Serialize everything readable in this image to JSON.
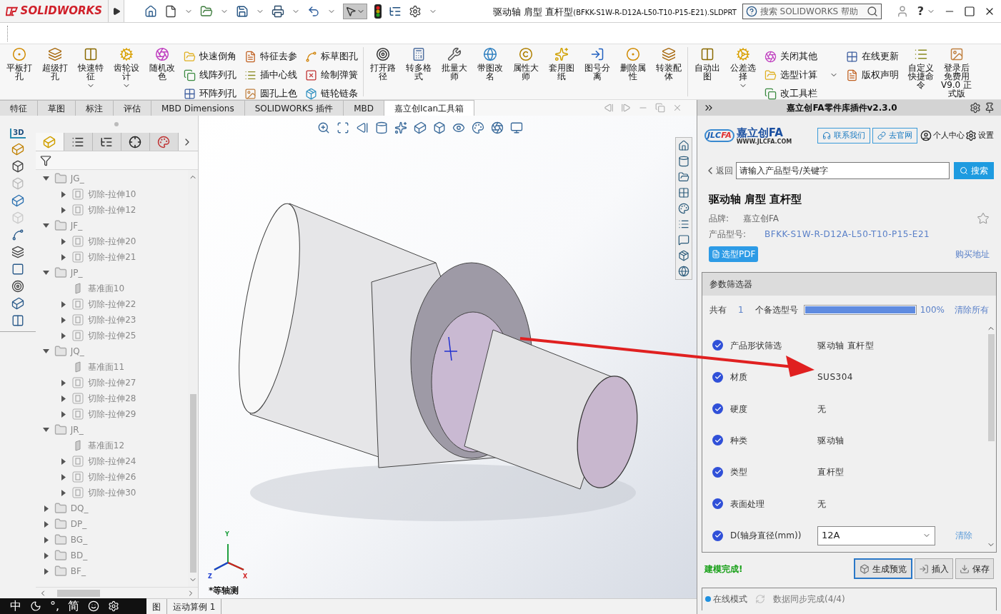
{
  "app": {
    "logo": "SOLIDWORKS",
    "title_main": "驱动轴 肩型 直杆型",
    "title_suffix": "(BFKK-S1W-R-D12A-L50-T10-P15-E21).SLDPRT",
    "help_search": {
      "placeholder": "搜索 SOLIDWORKS 帮助"
    },
    "help_mark": "?"
  },
  "ribbon": {
    "sections": [
      {
        "items": [
          {
            "kind": "large",
            "label": "平板打孔",
            "dropdown": false
          },
          {
            "kind": "large",
            "label": "超级打孔",
            "dropdown": false
          },
          {
            "kind": "large",
            "label": "快速特征",
            "dropdown": true
          },
          {
            "kind": "large",
            "label": "齿轮设计",
            "dropdown": true
          },
          {
            "kind": "large",
            "label": "随机改色",
            "dropdown": false
          },
          {
            "kind": "stack",
            "entries": [
              {
                "label": "快速倒角",
                "dropdown": false
              },
              {
                "label": "线阵列孔",
                "dropdown": false
              },
              {
                "label": "环阵列孔",
                "dropdown": false
              }
            ]
          },
          {
            "kind": "stack",
            "entries": [
              {
                "label": "特征去参",
                "dropdown": false
              },
              {
                "label": "插中心线",
                "dropdown": false
              },
              {
                "label": "圆孔上色",
                "dropdown": false
              }
            ]
          },
          {
            "kind": "stack",
            "entries": [
              {
                "label": "标草图孔",
                "dropdown": false
              },
              {
                "label": "绘制弹簧",
                "dropdown": false
              },
              {
                "label": "链轮链条",
                "dropdown": false
              }
            ]
          }
        ]
      },
      {
        "items": [
          {
            "kind": "large",
            "label": "打开路径",
            "dropdown": false
          },
          {
            "kind": "large",
            "label": "转多格式",
            "dropdown": false
          },
          {
            "kind": "large",
            "label": "批量大师",
            "dropdown": false
          },
          {
            "kind": "large",
            "label": "带图改名",
            "dropdown": false
          },
          {
            "kind": "large",
            "label": "属性大师",
            "dropdown": false
          },
          {
            "kind": "large",
            "label": "套用图纸",
            "dropdown": false
          },
          {
            "kind": "large",
            "label": "图号分离",
            "dropdown": false
          },
          {
            "kind": "large",
            "label": "删除属性",
            "dropdown": false
          },
          {
            "kind": "large",
            "label": "转装配体",
            "dropdown": false
          }
        ]
      },
      {
        "items": [
          {
            "kind": "large",
            "label": "自动出图",
            "dropdown": false
          },
          {
            "kind": "large",
            "label": "公差选择",
            "dropdown": true
          },
          {
            "kind": "stack",
            "entries": [
              {
                "label": "关闭其他",
                "dropdown": false
              },
              {
                "label": "选型计算",
                "dropdown": true
              },
              {
                "label": "改工具栏",
                "dropdown": false
              }
            ]
          },
          {
            "kind": "stack",
            "entries": [
              {
                "label": "在线更新",
                "dropdown": false
              },
              {
                "label": "版权声明",
                "dropdown": false
              }
            ]
          },
          {
            "kind": "large",
            "label": "自定义快捷命令",
            "dropdown": false
          },
          {
            "kind": "large",
            "label": "登录后免费用 V9.0 正式版",
            "dropdown": false
          }
        ]
      }
    ]
  },
  "tabs": [
    {
      "label": "特征",
      "selected": false
    },
    {
      "label": "草图",
      "selected": false
    },
    {
      "label": "标注",
      "selected": false
    },
    {
      "label": "评估",
      "selected": false
    },
    {
      "label": "MBD Dimensions",
      "selected": false
    },
    {
      "label": "SOLIDWORKS 插件",
      "selected": false
    },
    {
      "label": "MBD",
      "selected": false
    },
    {
      "label": "嘉立创Ican工具箱",
      "selected": true
    }
  ],
  "command_strip": {
    "badge": "3D"
  },
  "tree_panel": {
    "tabs": [
      {
        "selected": true
      },
      {
        "selected": false
      },
      {
        "selected": false
      },
      {
        "selected": false
      },
      {
        "selected": false
      }
    ],
    "nodes": [
      {
        "label": "JG_",
        "kind": "folder",
        "expanded": true,
        "children": [
          {
            "label": "切除-拉伸10",
            "kind": "cut",
            "expanded": false
          },
          {
            "label": "切除-拉伸12",
            "kind": "cut",
            "expanded": false
          }
        ]
      },
      {
        "label": "JF_",
        "kind": "folder",
        "expanded": true,
        "children": [
          {
            "label": "切除-拉伸20",
            "kind": "cut",
            "expanded": false
          },
          {
            "label": "切除-拉伸21",
            "kind": "cut",
            "expanded": false
          }
        ]
      },
      {
        "label": "JP_",
        "kind": "folder",
        "expanded": true,
        "children": [
          {
            "label": "基准面10",
            "kind": "plane"
          },
          {
            "label": "切除-拉伸22",
            "kind": "cut",
            "expanded": false
          },
          {
            "label": "切除-拉伸23",
            "kind": "cut",
            "expanded": false
          },
          {
            "label": "切除-拉伸25",
            "kind": "cut",
            "expanded": false
          }
        ]
      },
      {
        "label": "JQ_",
        "kind": "folder",
        "expanded": true,
        "children": [
          {
            "label": "基准面11",
            "kind": "plane"
          },
          {
            "label": "切除-拉伸27",
            "kind": "cut",
            "expanded": false
          },
          {
            "label": "切除-拉伸28",
            "kind": "cut",
            "expanded": false
          },
          {
            "label": "切除-拉伸29",
            "kind": "cut",
            "expanded": false
          }
        ]
      },
      {
        "label": "JR_",
        "kind": "folder",
        "expanded": true,
        "children": [
          {
            "label": "基准面12",
            "kind": "plane"
          },
          {
            "label": "切除-拉伸24",
            "kind": "cut",
            "expanded": false
          },
          {
            "label": "切除-拉伸26",
            "kind": "cut",
            "expanded": false
          },
          {
            "label": "切除-拉伸30",
            "kind": "cut",
            "expanded": false
          }
        ]
      },
      {
        "label": "DQ_",
        "kind": "folder",
        "expanded": false
      },
      {
        "label": "DP_",
        "kind": "folder",
        "expanded": false
      },
      {
        "label": "BG_",
        "kind": "folder",
        "expanded": false
      },
      {
        "label": "BD_",
        "kind": "folder",
        "expanded": false
      },
      {
        "label": "BF_",
        "kind": "folder",
        "expanded": false
      }
    ]
  },
  "viewport": {
    "axes": {
      "y": "Y",
      "z": "Z",
      "x": "X"
    },
    "view_label": "*等轴测"
  },
  "bottom_tabs": [
    {
      "label": "图"
    },
    {
      "label": "运动算例 1"
    }
  ],
  "ime_bar": {
    "mode": "中",
    "punctuation": "°,",
    "script": "简"
  },
  "plugin": {
    "header": "嘉立创FA零件库插件v2.3.0",
    "logo": {
      "mark_left": "JLC",
      "mark_right": "FA",
      "name": "嘉立创FA",
      "url": "WWW.JLCFA.COM"
    },
    "contact": "联系我们",
    "website": "去官网",
    "account": "个人中心",
    "settings": "设置",
    "back": "返回",
    "search": {
      "placeholder": "请输入产品型号/关键字",
      "button": "搜索"
    },
    "product": {
      "title": "驱动轴 肩型 直杆型",
      "brand_label": "品牌:",
      "brand": "嘉立创FA",
      "model_label": "产品型号:",
      "model": "BFKK-S1W-R-D12A-L50-T10-P15-E21",
      "favorite": false
    },
    "pdf": "选型PDF",
    "buy": "购买地址",
    "filter": {
      "title": "参数筛选器",
      "total_label": "共有",
      "count": "1",
      "count_suffix": "个备选型号",
      "level": 1,
      "percent": "100%",
      "clear_all": "清除所有",
      "rows": [
        {
          "kind": "text",
          "label": "产品形状筛选",
          "value": "驱动轴 直杆型",
          "checked": true
        },
        {
          "kind": "text",
          "label": "材质",
          "value": "SUS304",
          "checked": true
        },
        {
          "kind": "text",
          "label": "硬度",
          "value": "无",
          "checked": true
        },
        {
          "kind": "text",
          "label": "种类",
          "value": "驱动轴",
          "checked": true
        },
        {
          "kind": "text",
          "label": "类型",
          "value": "直杆型",
          "checked": true
        },
        {
          "kind": "text",
          "label": "表面处理",
          "value": "无",
          "checked": true
        },
        {
          "kind": "select",
          "label": "D(轴身直径(mm))",
          "value": "12A",
          "action": "清除",
          "checked": true
        }
      ]
    },
    "status": "建模完成!",
    "actions": [
      {
        "label": "生成预览",
        "selected": true
      },
      {
        "label": "插入",
        "selected": false
      },
      {
        "label": "保存",
        "selected": false
      }
    ],
    "footer": {
      "mode": "在线模式",
      "color": "#1e90e0",
      "sync": "数据同步完成(4/4)"
    }
  }
}
